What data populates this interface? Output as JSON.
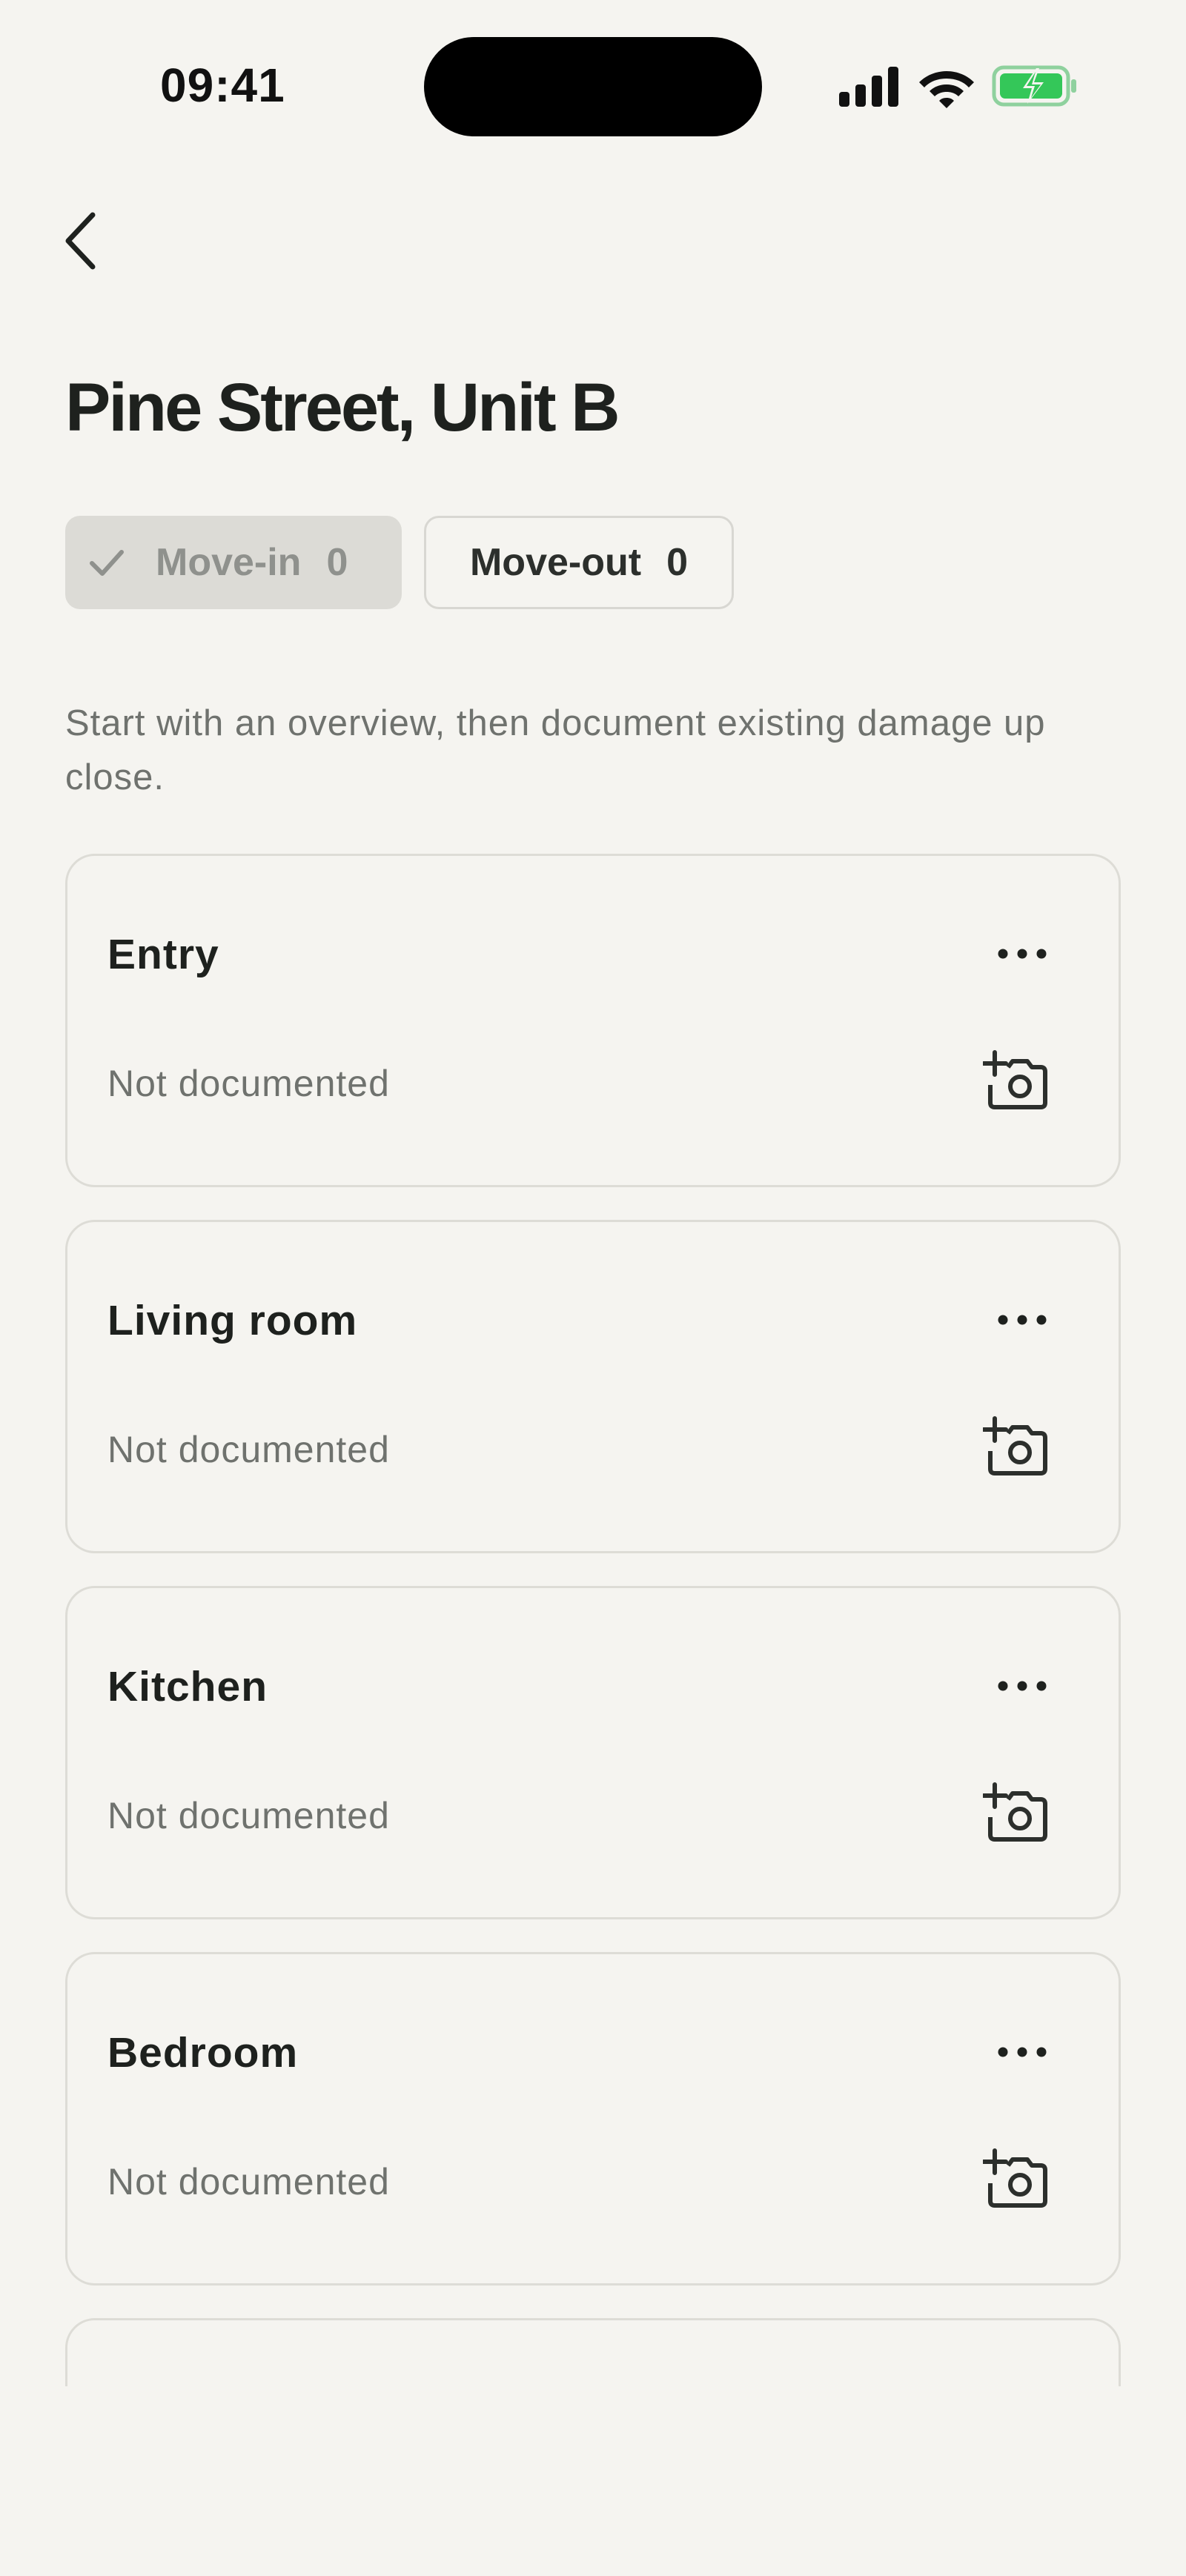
{
  "status_bar": {
    "time": "09:41"
  },
  "header": {
    "title": "Pine Street, Unit B"
  },
  "tabs": [
    {
      "label": "Move-in",
      "count": "0",
      "selected": true
    },
    {
      "label": "Move-out",
      "count": "0",
      "selected": false
    }
  ],
  "intro": "Start with an overview, then document existing damage up close.",
  "rooms": [
    {
      "name": "Entry",
      "status": "Not documented"
    },
    {
      "name": "Living room",
      "status": "Not documented"
    },
    {
      "name": "Kitchen",
      "status": "Not documented"
    },
    {
      "name": "Bedroom",
      "status": "Not documented"
    }
  ],
  "icons": {
    "back": "chevron-left-icon",
    "more": "ellipsis-icon",
    "camera": "add-photo-icon",
    "check": "check-icon",
    "signal": "cellular-signal-icon",
    "wifi": "wifi-icon",
    "battery": "battery-charging-icon"
  },
  "colors": {
    "background": "#f5f4f0",
    "text_primary": "#1e211e",
    "text_secondary": "#6f726e",
    "card_border": "#dddcd6",
    "tab_selected_bg": "#dcdbd6",
    "battery_charging": "#34c759"
  }
}
